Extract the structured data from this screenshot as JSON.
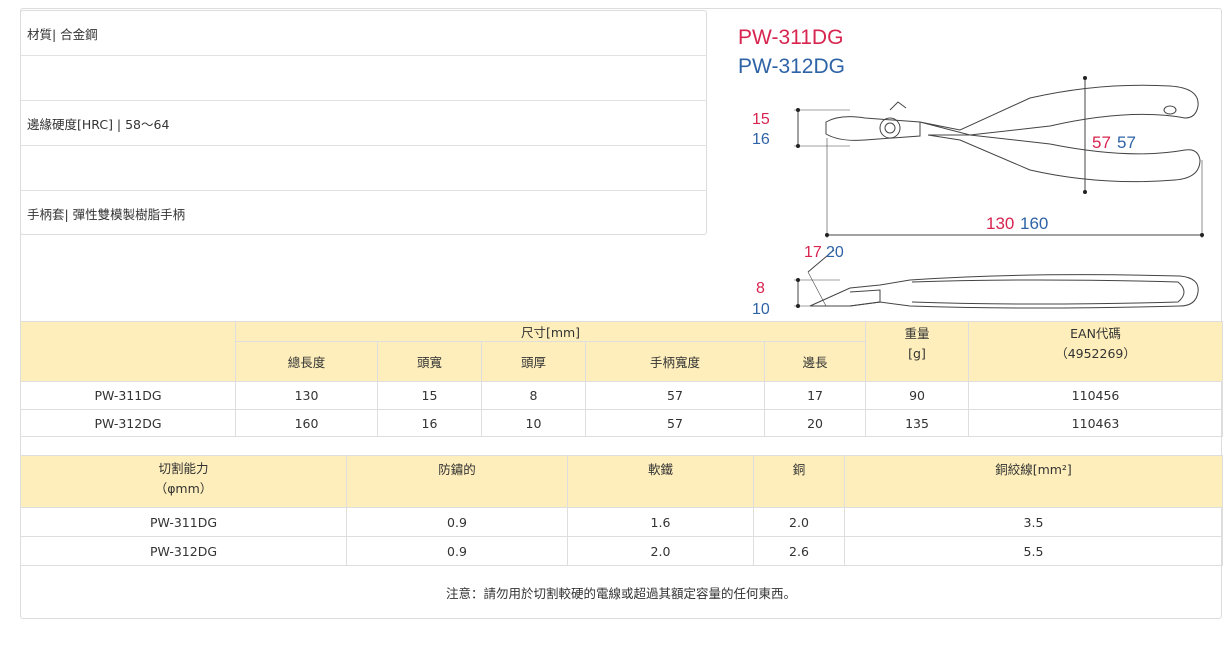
{
  "specs": [
    {
      "label": "材質| 合金鋼"
    },
    {
      "label": ""
    },
    {
      "label": "邊緣硬度[HRC] | 58～64"
    },
    {
      "label": ""
    },
    {
      "label": "手柄套| 彈性雙模製樹脂手柄"
    }
  ],
  "diagram": {
    "model_a": "PW-311DG",
    "model_b": "PW-312DG",
    "width_a": "15",
    "width_b": "16",
    "handle_a": "57",
    "handle_b": "57",
    "length_a": "130",
    "length_b": "160",
    "edge_a": "17",
    "edge_b": "20",
    "thick_a": "8",
    "thick_b": "10",
    "color_a": "#d7254f",
    "color_b": "#2e63a6"
  },
  "dimensions_table": {
    "group_header": "尺寸[mm]",
    "weight_header": "重量",
    "weight_unit": "[g]",
    "ean_header": "EAN代碼",
    "ean_prefix": "（4952269）",
    "columns": [
      "總長度",
      "頭寬",
      "頭厚",
      "手柄寬度",
      "邊長"
    ],
    "rows": [
      {
        "model": "PW-311DG",
        "values": [
          "130",
          "15",
          "8",
          "57",
          "17"
        ],
        "weight": "90",
        "ean": "110456"
      },
      {
        "model": "PW-312DG",
        "values": [
          "160",
          "16",
          "10",
          "57",
          "20"
        ],
        "weight": "135",
        "ean": "110463"
      }
    ]
  },
  "capacity_table": {
    "header_line1": "切割能力",
    "header_line2": "（φmm）",
    "columns": [
      "防鏽的",
      "軟鐵",
      "銅",
      "銅絞線[mm²]"
    ],
    "rows": [
      {
        "model": "PW-311DG",
        "values": [
          "0.9",
          "1.6",
          "2.0",
          "3.5"
        ]
      },
      {
        "model": "PW-312DG",
        "values": [
          "0.9",
          "2.0",
          "2.6",
          "5.5"
        ]
      }
    ]
  },
  "note": "注意：請勿用於切割較硬的電線或超過其額定容量的任何東西。",
  "colors": {
    "header_bg": "#fdeebb",
    "border": "#dedede"
  }
}
